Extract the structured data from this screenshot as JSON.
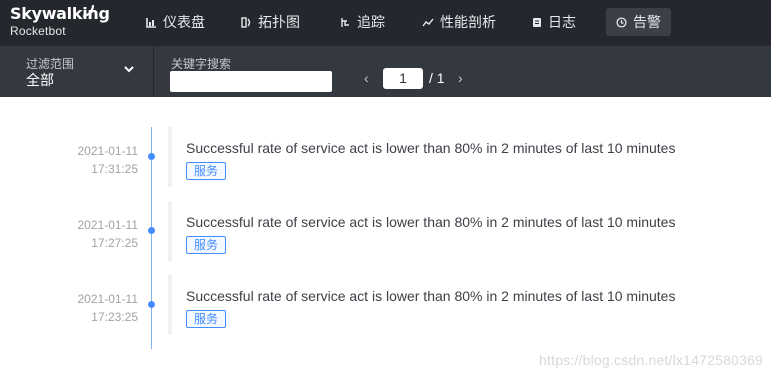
{
  "app": {
    "logo_main": "Skywalking",
    "logo_sub": "Rocketbot"
  },
  "nav": [
    {
      "label": "仪表盘",
      "icon": "dashboard-icon"
    },
    {
      "label": "拓扑图",
      "icon": "topology-icon"
    },
    {
      "label": "追踪",
      "icon": "trace-icon"
    },
    {
      "label": "性能剖析",
      "icon": "profile-icon"
    },
    {
      "label": "日志",
      "icon": "log-icon"
    },
    {
      "label": "告警",
      "icon": "alarm-icon",
      "active": true
    }
  ],
  "filter": {
    "label": "过滤范围",
    "value": "全部"
  },
  "search": {
    "label": "关键字搜索",
    "value": ""
  },
  "pagination": {
    "current": "1",
    "total": "/ 1"
  },
  "alarms": [
    {
      "date": "2021-01-11",
      "time": "17:31:25",
      "message": "Successful rate of service act is lower than 80% in 2 minutes of last 10 minutes",
      "tag": "服务"
    },
    {
      "date": "2021-01-11",
      "time": "17:27:25",
      "message": "Successful rate of service act is lower than 80% in 2 minutes of last 10 minutes",
      "tag": "服务"
    },
    {
      "date": "2021-01-11",
      "time": "17:23:25",
      "message": "Successful rate of service act is lower than 80% in 2 minutes of last 10 minutes",
      "tag": "服务"
    }
  ],
  "watermark": "https://blog.csdn.net/lx1472580369",
  "colors": {
    "topbar": "#24272d",
    "subbar": "#343840",
    "accent": "#448dfe"
  }
}
